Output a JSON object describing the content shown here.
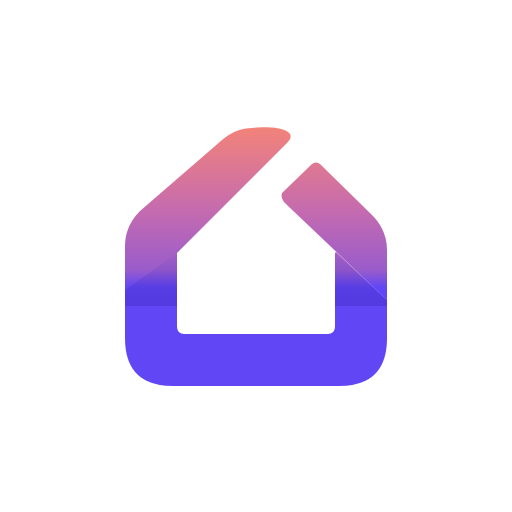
{
  "logo": {
    "icon": "house-icon",
    "colors": {
      "top": "#F2837A",
      "middle": "#C56BAF",
      "lower": "#9A5CCB",
      "base": "#6046F5",
      "shadow": "#3C24B8"
    }
  }
}
